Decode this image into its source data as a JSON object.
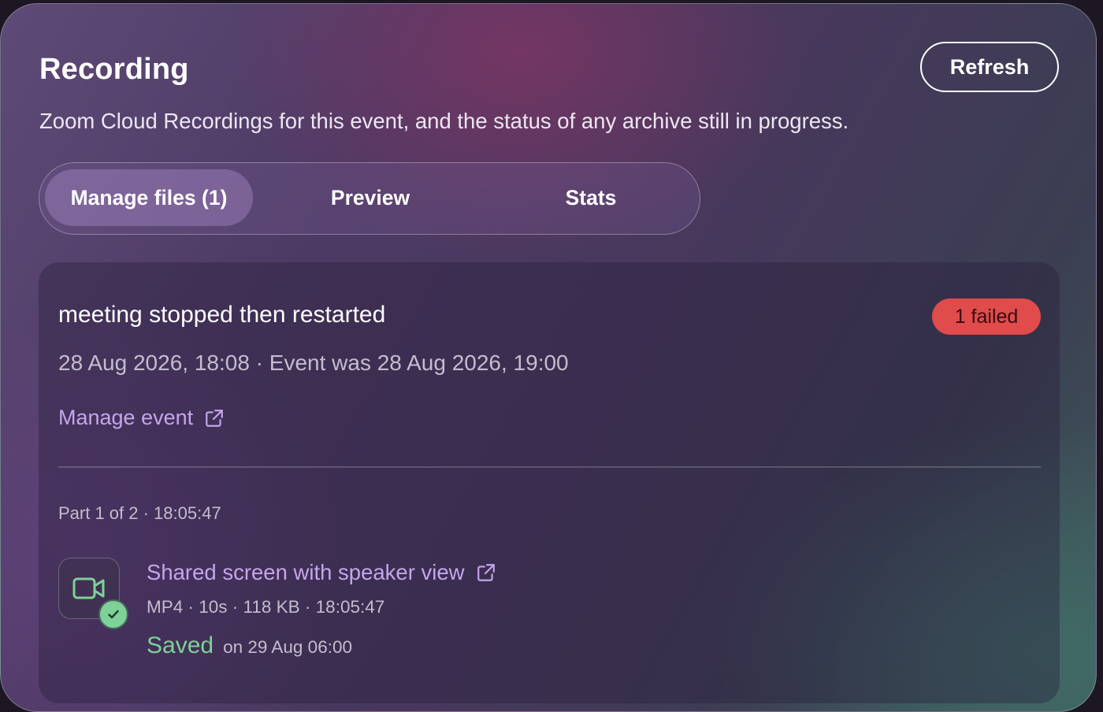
{
  "header": {
    "title": "Recording",
    "subtitle": "Zoom Cloud Recordings for this event, and the status of any archive still in progress.",
    "refresh_label": "Refresh"
  },
  "tabs": [
    {
      "label": "Manage files (1)",
      "active": true
    },
    {
      "label": "Preview",
      "active": false
    },
    {
      "label": "Stats",
      "active": false
    }
  ],
  "meeting": {
    "title": "meeting stopped then restarted",
    "badge": "1 failed",
    "meta": "28 Aug 2026, 18:08 · Event was 28 Aug 2026, 19:00",
    "manage_link": "Manage event",
    "part_label": "Part 1 of 2 · 18:05:47",
    "file": {
      "icon": "video-camera-icon",
      "name": "Shared screen with speaker view",
      "meta": "MP4 · 10s · 118 KB · 18:05:47",
      "status": "Saved",
      "status_when": "on 29 Aug 06:00"
    }
  },
  "colors": {
    "accent_link": "#c4a6ea",
    "success": "#7ed198",
    "failed_badge": "#e04b4b"
  }
}
